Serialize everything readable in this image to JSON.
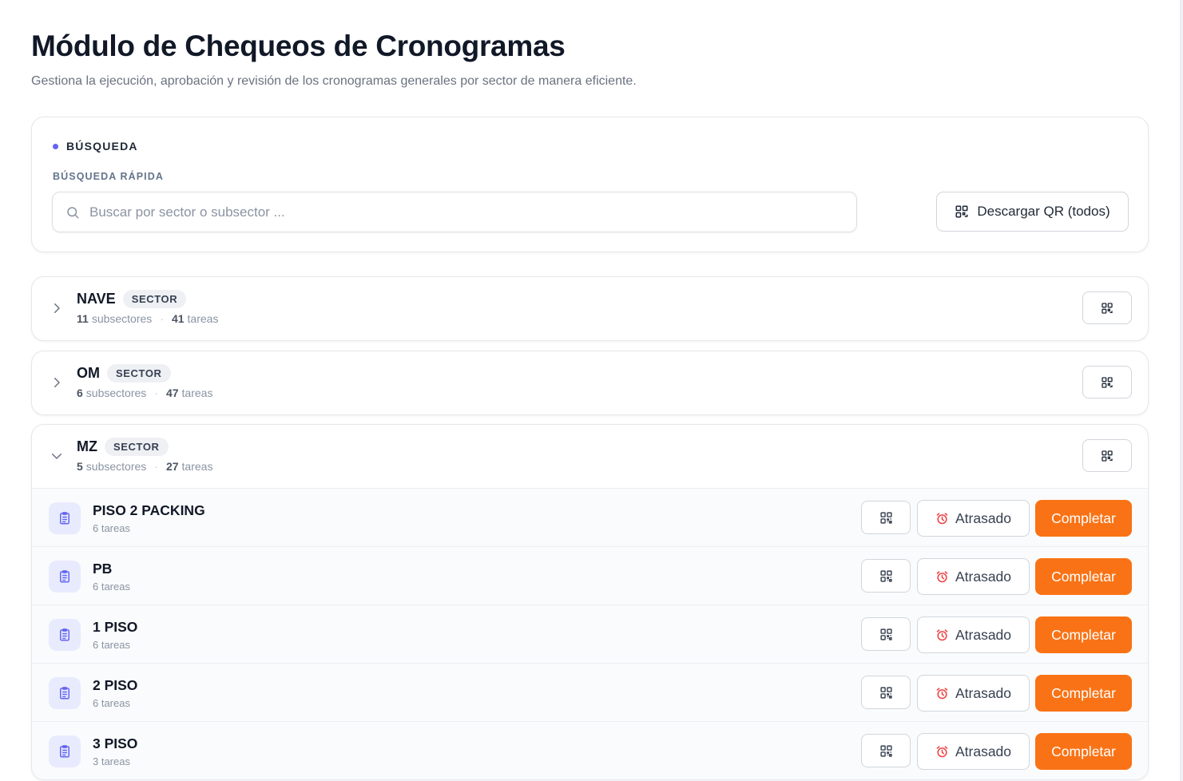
{
  "header": {
    "title": "Módulo de Chequeos de Cronogramas",
    "subtitle": "Gestiona la ejecución, aprobación y revisión de los cronogramas generales por sector de manera eficiente."
  },
  "search": {
    "section_label": "BÚSQUEDA",
    "field_label": "BÚSQUEDA RÁPIDA",
    "placeholder": "Buscar por sector o subsector ...",
    "value": "",
    "download_all_label": "Descargar QR (todos)"
  },
  "colors": {
    "accent": "#6366f1",
    "primary_action": "#f97316",
    "status_icon": "#ef4444"
  },
  "sectors": [
    {
      "name": "NAVE",
      "badge": "SECTOR",
      "subsector_count": "11",
      "subsector_label": "subsectores",
      "task_count": "41",
      "task_label": "tareas",
      "expanded": false
    },
    {
      "name": "OM",
      "badge": "SECTOR",
      "subsector_count": "6",
      "subsector_label": "subsectores",
      "task_count": "47",
      "task_label": "tareas",
      "expanded": false
    },
    {
      "name": "MZ",
      "badge": "SECTOR",
      "subsector_count": "5",
      "subsector_label": "subsectores",
      "task_count": "27",
      "task_label": "tareas",
      "expanded": true,
      "subsectors": [
        {
          "name": "PISO 2 PACKING",
          "tasks": "6 tareas",
          "status": "Atrasado",
          "action": "Completar"
        },
        {
          "name": "PB",
          "tasks": "6 tareas",
          "status": "Atrasado",
          "action": "Completar"
        },
        {
          "name": "1 PISO",
          "tasks": "6 tareas",
          "status": "Atrasado",
          "action": "Completar"
        },
        {
          "name": "2 PISO",
          "tasks": "6 tareas",
          "status": "Atrasado",
          "action": "Completar"
        },
        {
          "name": "3 PISO",
          "tasks": "3 tareas",
          "status": "Atrasado",
          "action": "Completar"
        }
      ]
    }
  ],
  "icons": {
    "search": "search-icon",
    "qr": "qr-code-icon",
    "chevron_collapsed": "chevron-right-icon",
    "chevron_expanded": "chevron-down-icon",
    "subsector": "clipboard-list-icon",
    "status": "alarm-clock-icon"
  }
}
